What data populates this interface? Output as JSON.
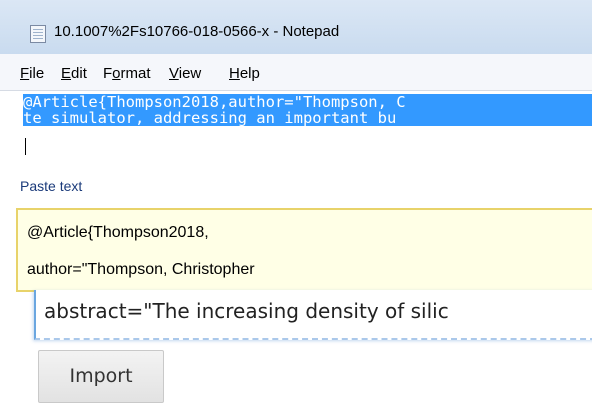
{
  "notepad": {
    "title": "10.1007%2Fs10766-018-0566-x - Notepad",
    "menu": [
      {
        "accel": "F",
        "rest": "ile"
      },
      {
        "accel": "E",
        "rest": "dit"
      },
      {
        "pre": "F",
        "accel": "o",
        "rest": "rmat"
      },
      {
        "accel": "V",
        "rest": "iew"
      },
      {
        "accel": "H",
        "rest": "elp"
      }
    ],
    "selected_lines": [
      "@Article{Thompson2018,author=\"Thompson, C",
      "te simulator, addressing an important bu"
    ]
  },
  "paste": {
    "label": "Paste text",
    "lines": [
      "@Article{Thompson2018,",
      "author=\"Thompson, Christopher"
    ]
  },
  "abstract_field": {
    "value": "abstract=\"The increasing density of silic"
  },
  "import_button": {
    "label": "Import"
  },
  "colors": {
    "selection": "#3399ff",
    "paste_background": "#ffffe6",
    "paste_border": "#e8d36a",
    "label_text": "#1a3a7a"
  }
}
